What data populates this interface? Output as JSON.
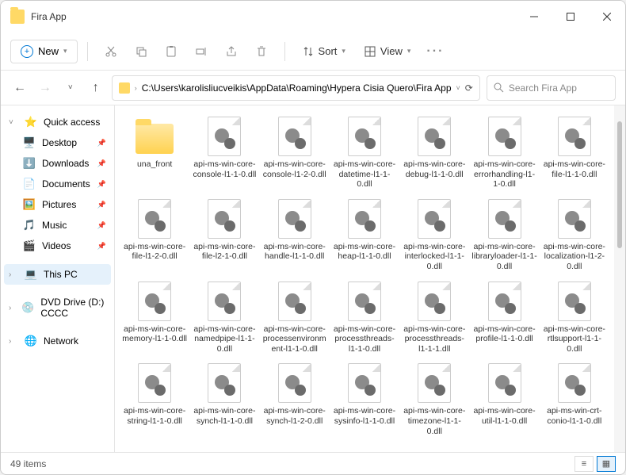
{
  "titlebar": {
    "title": "Fira App"
  },
  "toolbar": {
    "new_label": "New",
    "sort_label": "Sort",
    "view_label": "View"
  },
  "navbar": {
    "path": "C:\\Users\\karolisliucveikis\\AppData\\Roaming\\Hypera Cisia Quero\\Fira App",
    "search_placeholder": "Search Fira App"
  },
  "sidebar": {
    "items": [
      {
        "label": "Quick access",
        "icon": "⭐",
        "chevron": "˅"
      },
      {
        "label": "Desktop",
        "icon": "🖥️",
        "indent": true,
        "pin": true
      },
      {
        "label": "Downloads",
        "icon": "⬇️",
        "indent": true,
        "pin": true
      },
      {
        "label": "Documents",
        "icon": "📄",
        "indent": true,
        "pin": true
      },
      {
        "label": "Pictures",
        "icon": "🖼️",
        "indent": true,
        "pin": true
      },
      {
        "label": "Music",
        "icon": "🎵",
        "indent": true,
        "pin": true
      },
      {
        "label": "Videos",
        "icon": "🎬",
        "indent": true,
        "pin": true
      },
      {
        "label": "This PC",
        "icon": "💻",
        "chevron": "›",
        "selected": true
      },
      {
        "label": "DVD Drive (D:) CCCC",
        "icon": "💿",
        "chevron": "›"
      },
      {
        "label": "Network",
        "icon": "🌐",
        "chevron": "›"
      }
    ]
  },
  "files": [
    {
      "name": "una_front",
      "type": "folder"
    },
    {
      "name": "api-ms-win-core-console-l1-1-0.dll",
      "type": "dll"
    },
    {
      "name": "api-ms-win-core-console-l1-2-0.dll",
      "type": "dll"
    },
    {
      "name": "api-ms-win-core-datetime-l1-1-0.dll",
      "type": "dll"
    },
    {
      "name": "api-ms-win-core-debug-l1-1-0.dll",
      "type": "dll"
    },
    {
      "name": "api-ms-win-core-errorhandling-l1-1-0.dll",
      "type": "dll"
    },
    {
      "name": "api-ms-win-core-file-l1-1-0.dll",
      "type": "dll"
    },
    {
      "name": "api-ms-win-core-file-l1-2-0.dll",
      "type": "dll"
    },
    {
      "name": "api-ms-win-core-file-l2-1-0.dll",
      "type": "dll"
    },
    {
      "name": "api-ms-win-core-handle-l1-1-0.dll",
      "type": "dll"
    },
    {
      "name": "api-ms-win-core-heap-l1-1-0.dll",
      "type": "dll"
    },
    {
      "name": "api-ms-win-core-interlocked-l1-1-0.dll",
      "type": "dll"
    },
    {
      "name": "api-ms-win-core-libraryloader-l1-1-0.dll",
      "type": "dll"
    },
    {
      "name": "api-ms-win-core-localization-l1-2-0.dll",
      "type": "dll"
    },
    {
      "name": "api-ms-win-core-memory-l1-1-0.dll",
      "type": "dll"
    },
    {
      "name": "api-ms-win-core-namedpipe-l1-1-0.dll",
      "type": "dll"
    },
    {
      "name": "api-ms-win-core-processenvironment-l1-1-0.dll",
      "type": "dll"
    },
    {
      "name": "api-ms-win-core-processthreads-l1-1-0.dll",
      "type": "dll"
    },
    {
      "name": "api-ms-win-core-processthreads-l1-1-1.dll",
      "type": "dll"
    },
    {
      "name": "api-ms-win-core-profile-l1-1-0.dll",
      "type": "dll"
    },
    {
      "name": "api-ms-win-core-rtlsupport-l1-1-0.dll",
      "type": "dll"
    },
    {
      "name": "api-ms-win-core-string-l1-1-0.dll",
      "type": "dll"
    },
    {
      "name": "api-ms-win-core-synch-l1-1-0.dll",
      "type": "dll"
    },
    {
      "name": "api-ms-win-core-synch-l1-2-0.dll",
      "type": "dll"
    },
    {
      "name": "api-ms-win-core-sysinfo-l1-1-0.dll",
      "type": "dll"
    },
    {
      "name": "api-ms-win-core-timezone-l1-1-0.dll",
      "type": "dll"
    },
    {
      "name": "api-ms-win-core-util-l1-1-0.dll",
      "type": "dll"
    },
    {
      "name": "api-ms-win-crt-conio-l1-1-0.dll",
      "type": "dll"
    }
  ],
  "statusbar": {
    "count": "49 items"
  }
}
